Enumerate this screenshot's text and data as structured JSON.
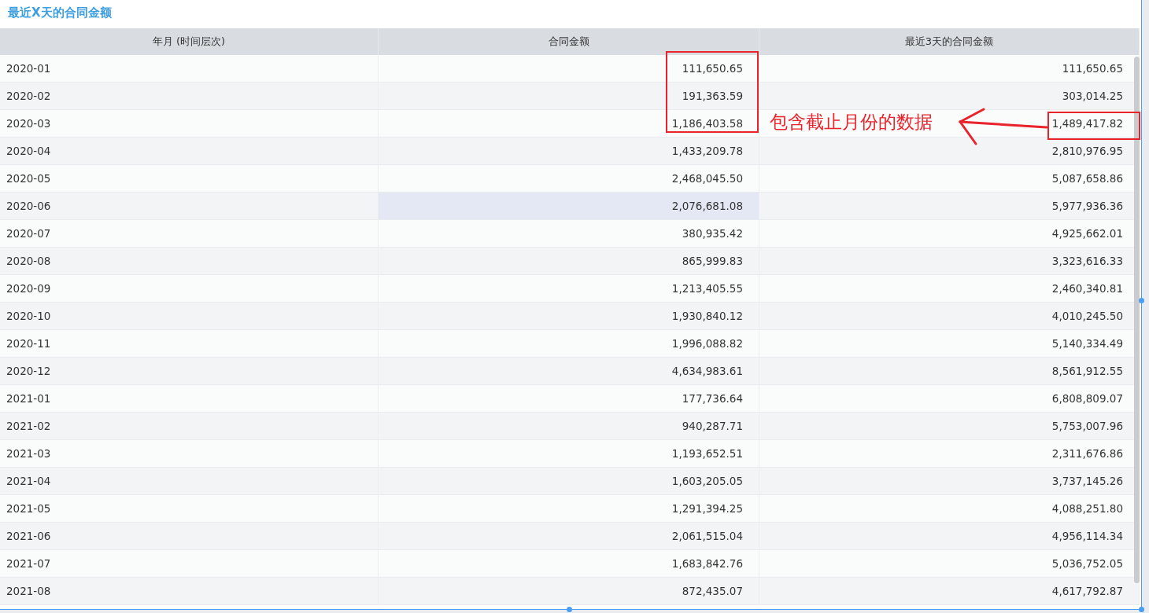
{
  "title": "最近X天的合同金额",
  "table": {
    "columns": [
      "年月 (时间层次)",
      "合同金额",
      "最近3天的合同金额"
    ],
    "rows": [
      {
        "month": "2020-01",
        "amount": "111,650.65",
        "last_3": "111,650.65",
        "selected": false
      },
      {
        "month": "2020-02",
        "amount": "191,363.59",
        "last_3": "303,014.25",
        "selected": false
      },
      {
        "month": "2020-03",
        "amount": "1,186,403.58",
        "last_3": "1,489,417.82",
        "selected": false
      },
      {
        "month": "2020-04",
        "amount": "1,433,209.78",
        "last_3": "2,810,976.95",
        "selected": false
      },
      {
        "month": "2020-05",
        "amount": "2,468,045.50",
        "last_3": "5,087,658.86",
        "selected": false
      },
      {
        "month": "2020-06",
        "amount": "2,076,681.08",
        "last_3": "5,977,936.36",
        "selected": true
      },
      {
        "month": "2020-07",
        "amount": "380,935.42",
        "last_3": "4,925,662.01",
        "selected": false
      },
      {
        "month": "2020-08",
        "amount": "865,999.83",
        "last_3": "3,323,616.33",
        "selected": false
      },
      {
        "month": "2020-09",
        "amount": "1,213,405.55",
        "last_3": "2,460,340.81",
        "selected": false
      },
      {
        "month": "2020-10",
        "amount": "1,930,840.12",
        "last_3": "4,010,245.50",
        "selected": false
      },
      {
        "month": "2020-11",
        "amount": "1,996,088.82",
        "last_3": "5,140,334.49",
        "selected": false
      },
      {
        "month": "2020-12",
        "amount": "4,634,983.61",
        "last_3": "8,561,912.55",
        "selected": false
      },
      {
        "month": "2021-01",
        "amount": "177,736.64",
        "last_3": "6,808,809.07",
        "selected": false
      },
      {
        "month": "2021-02",
        "amount": "940,287.71",
        "last_3": "5,753,007.96",
        "selected": false
      },
      {
        "month": "2021-03",
        "amount": "1,193,652.51",
        "last_3": "2,311,676.86",
        "selected": false
      },
      {
        "month": "2021-04",
        "amount": "1,603,205.05",
        "last_3": "3,737,145.26",
        "selected": false
      },
      {
        "month": "2021-05",
        "amount": "1,291,394.25",
        "last_3": "4,088,251.80",
        "selected": false
      },
      {
        "month": "2021-06",
        "amount": "2,061,515.04",
        "last_3": "4,956,114.34",
        "selected": false
      },
      {
        "month": "2021-07",
        "amount": "1,683,842.76",
        "last_3": "5,036,752.05",
        "selected": false
      },
      {
        "month": "2021-08",
        "amount": "872,435.07",
        "last_3": "4,617,792.87",
        "selected": false
      }
    ]
  },
  "annotation": {
    "text": "包含截止月份的数据"
  }
}
